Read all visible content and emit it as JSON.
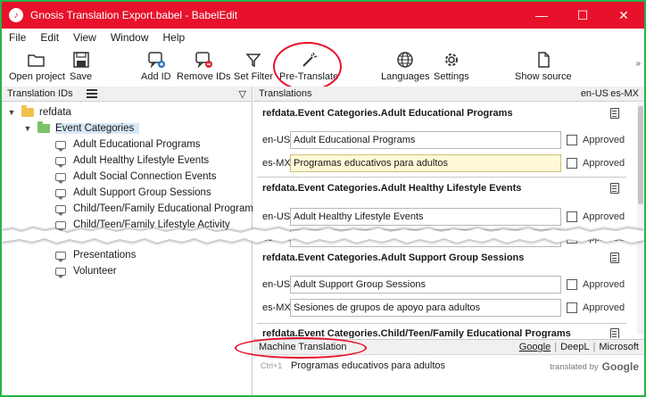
{
  "window": {
    "title": "Gnosis Translation Export.babel - BabelEdit",
    "controls": [
      "—",
      "☐",
      "✕"
    ]
  },
  "menu": [
    "File",
    "Edit",
    "View",
    "Window",
    "Help"
  ],
  "toolbar": {
    "open_project": "Open project",
    "save": "Save",
    "add_id": "Add ID",
    "remove_ids": "Remove IDs",
    "set_filter": "Set Filter",
    "pre_translate": "Pre-Translate",
    "languages": "Languages",
    "settings": "Settings",
    "show_source": "Show source",
    "more": "»"
  },
  "left_panel": {
    "header": "Translation IDs",
    "tree": {
      "root": "refdata",
      "folder": "Event Categories",
      "items_before_tear": [
        "Adult Educational Programs",
        "Adult Healthy Lifestyle Events",
        "Adult Social Connection Events",
        "Adult Support Group Sessions",
        "Child/Teen/Family Educational Programs",
        "Child/Teen/Family Lifestyle Activity"
      ],
      "items_after_tear": [
        "Presentations",
        "Volunteer"
      ]
    }
  },
  "right_panel": {
    "header": "Translations",
    "lang_a": "en-US",
    "lang_b": "es-MX",
    "cards": [
      {
        "title": "refdata.Event Categories.Adult Educational Programs",
        "rows": [
          {
            "lang": "en-US",
            "value": "Adult Educational Programs",
            "approved": "Approved"
          },
          {
            "lang": "es-MX",
            "value": "Programas educativos para adultos",
            "approved": "Approved"
          }
        ]
      },
      {
        "title": "refdata.Event Categories.Adult Healthy Lifestyle Events",
        "rows": [
          {
            "lang": "en-US",
            "value": "Adult Healthy Lifestyle Events",
            "approved": "Approved"
          },
          {
            "lang": "es-MX",
            "value": "",
            "approved": "Approved"
          }
        ]
      },
      {
        "title": "refdata.Event Categories.Adult Support Group Sessions",
        "rows": [
          {
            "lang": "en-US",
            "value": "Adult Support Group Sessions",
            "approved": "Approved"
          },
          {
            "lang": "es-MX",
            "value": "Sesiones de grupos de apoyo para adultos",
            "approved": "Approved"
          }
        ]
      },
      {
        "title": "refdata.Event Categories.Child/Teen/Family Educational Programs"
      }
    ]
  },
  "machine_translation": {
    "label": "Machine Translation",
    "providers": [
      "Google",
      "DeepL",
      "Microsoft"
    ],
    "separator": "|",
    "shortcut": "Ctrl+1",
    "suggestion": "Programas educativos para adultos",
    "credit_prefix": "translated by",
    "credit_brand": "Google"
  },
  "colors": {
    "titlebar": "#e8112b",
    "frame_border": "#27b34a",
    "highlight_ring": "#e8112b",
    "active_field": "#fff9d6"
  }
}
